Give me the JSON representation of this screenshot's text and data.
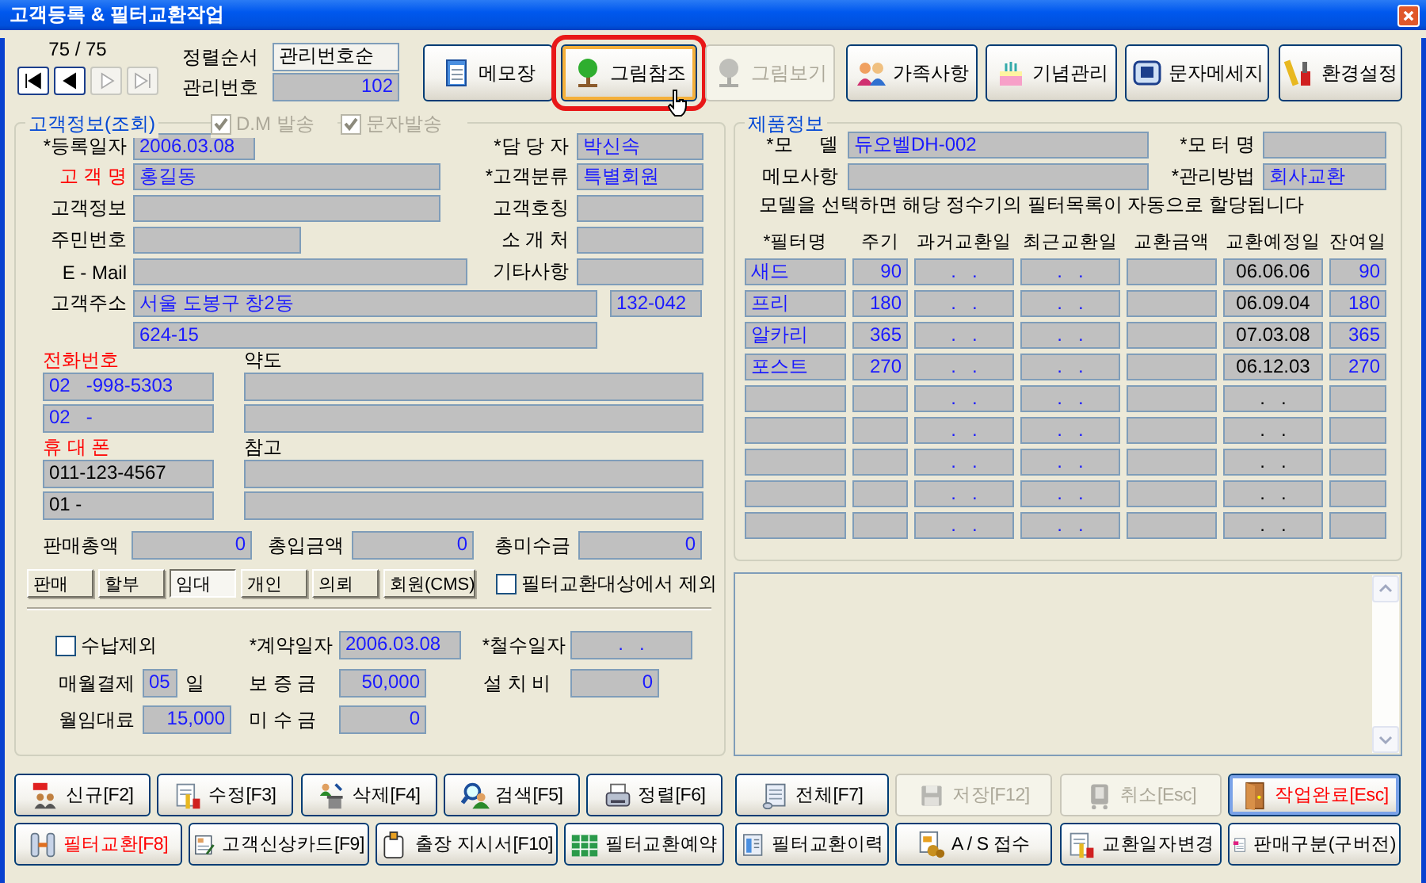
{
  "window": {
    "title": "고객등록 & 필터교환작업"
  },
  "record_nav": {
    "counter": "75 / 75",
    "buttons": [
      {
        "kind": "first",
        "disabled": false
      },
      {
        "kind": "prev",
        "disabled": false
      },
      {
        "kind": "next",
        "disabled": true
      },
      {
        "kind": "last",
        "disabled": true
      }
    ]
  },
  "sort": {
    "label": "정렬순서",
    "value": "관리번호순"
  },
  "manage_no": {
    "label": "관리번호",
    "value": "102"
  },
  "toolbar": [
    {
      "label": "메모장",
      "disabled": false,
      "highlighted": false
    },
    {
      "label": "그림참조",
      "disabled": false,
      "highlighted": true
    },
    {
      "label": "그림보기",
      "disabled": true,
      "highlighted": false
    },
    {
      "label": "가족사항",
      "disabled": false,
      "highlighted": false
    },
    {
      "label": "기념관리",
      "disabled": false,
      "highlighted": false
    },
    {
      "label": "문자메세지",
      "disabled": false,
      "highlighted": false
    },
    {
      "label": "환경설정",
      "disabled": false,
      "highlighted": false
    }
  ],
  "customer": {
    "title": "고객정보(조회)",
    "options": [
      {
        "label": "D.M 발송",
        "checked": true,
        "disabled": true
      },
      {
        "label": "문자발송",
        "checked": true,
        "disabled": true
      }
    ],
    "reg_date": {
      "label": "*등록일자",
      "value": "2006.03.08"
    },
    "name": {
      "label": "고 객 명",
      "value": "홍길동",
      "emphasized": true
    },
    "info": {
      "label": "고객정보"
    },
    "resident_no": {
      "label": "주민번호"
    },
    "email": {
      "label": "E - Mail"
    },
    "address": {
      "label": "고객주소",
      "value": "서울 도봉구 창2동",
      "postal_code": "132-042",
      "detail": "624-15"
    },
    "manager": {
      "label": "*담 당 자",
      "value": "박신속"
    },
    "category": {
      "label": "*고객분류",
      "value": "특별회원"
    },
    "honorific": {
      "label": "고객호칭"
    },
    "referrer": {
      "label": "소 개 처"
    },
    "etc": {
      "label": "기타사항"
    },
    "phone": {
      "label": "전화번호",
      "emphasized": true,
      "values": [
        "02   -998-5303",
        "02   -"
      ]
    },
    "map": {
      "label": "약도"
    },
    "mobile": {
      "label": "휴 대 폰",
      "emphasized": true,
      "values": [
        "011-123-4567",
        "01 -"
      ]
    },
    "note": {
      "label": "참고"
    },
    "totals": [
      {
        "label": "판매총액",
        "value": "0"
      },
      {
        "label": "총입금액",
        "value": "0"
      },
      {
        "label": "총미수금",
        "value": "0"
      }
    ],
    "sale_types": [
      {
        "label": "판매",
        "selected": false
      },
      {
        "label": "할부",
        "selected": false
      },
      {
        "label": "임대",
        "selected": true
      },
      {
        "label": "개인",
        "selected": false
      },
      {
        "label": "의뢰",
        "selected": false
      },
      {
        "label": "회원(CMS)",
        "selected": false
      }
    ],
    "exclude_filter": {
      "label": "필터교환대상에서 제외",
      "checked": false
    }
  },
  "rental": {
    "exclude_payment": {
      "label": "수납제외",
      "checked": false
    },
    "contract_date": {
      "label": "*계약일자",
      "value": "2006.03.08"
    },
    "withdraw_date": {
      "label": "*철수일자",
      "value": ".   ."
    },
    "payment_day": {
      "label": "매월결제",
      "value": "05",
      "unit": "일"
    },
    "deposit": {
      "label": "보 증 금",
      "value": "50,000"
    },
    "install_fee": {
      "label": "설 치 비",
      "value": "0"
    },
    "monthly_fee": {
      "label": "월임대료",
      "value": "15,000"
    },
    "unpaid": {
      "label": "미 수 금",
      "value": "0"
    }
  },
  "product": {
    "title": "제품정보",
    "model": {
      "label": "*모     델",
      "value": "듀오벨DH-002"
    },
    "motor": {
      "label": "*모 터 명"
    },
    "memo": {
      "label": "메모사항"
    },
    "method": {
      "label": "*관리방법",
      "value": "회사교환"
    },
    "notice": "모델을 선택하면 해당 정수기의 필터목록이 자동으로 할당됩니다",
    "filters": {
      "columns": [
        "*필터명",
        "주기",
        "과거교환일",
        "최근교환일",
        "교환금액",
        "교환예정일",
        "잔여일"
      ],
      "rows": [
        {
          "name": "새드",
          "cycle": "90",
          "past": ".   .",
          "recent": ".   .",
          "next": "06.06.06",
          "remaining": "90"
        },
        {
          "name": "프리",
          "cycle": "180",
          "past": ".   .",
          "recent": ".   .",
          "next": "06.09.04",
          "remaining": "180"
        },
        {
          "name": "알카리",
          "cycle": "365",
          "past": ".   .",
          "recent": ".   .",
          "next": "07.03.08",
          "remaining": "365"
        },
        {
          "name": "포스트",
          "cycle": "270",
          "past": ".   .",
          "recent": ".   .",
          "next": "06.12.03",
          "remaining": "270"
        },
        {
          "past": ".   .",
          "recent": ".   .",
          "next": ".   ."
        },
        {
          "past": ".   .",
          "recent": ".   .",
          "next": ".   ."
        },
        {
          "past": ".   .",
          "recent": ".   .",
          "next": ".   ."
        },
        {
          "past": ".   .",
          "recent": ".   .",
          "next": ".   ."
        },
        {
          "past": ".   .",
          "recent": ".   .",
          "next": ".   ."
        }
      ]
    }
  },
  "buttons": [
    [
      {
        "label": "신규[F2]",
        "disabled": false,
        "emphasized": false,
        "focused": false
      },
      {
        "label": "수정[F3]",
        "disabled": false,
        "emphasized": false,
        "focused": false
      },
      {
        "label": "삭제[F4]",
        "disabled": false,
        "emphasized": false,
        "focused": false
      },
      {
        "label": "검색[F5]",
        "disabled": false,
        "emphasized": false,
        "focused": false
      },
      {
        "label": "정렬[F6]",
        "disabled": false,
        "emphasized": false,
        "focused": false
      },
      {
        "label": "전체[F7]",
        "disabled": false,
        "emphasized": false,
        "focused": false
      },
      {
        "label": "저장[F12]",
        "disabled": true,
        "emphasized": false,
        "focused": false
      },
      {
        "label": "취소[Esc]",
        "disabled": true,
        "emphasized": false,
        "focused": false
      },
      {
        "label": "작업완료[Esc]",
        "disabled": false,
        "emphasized": true,
        "focused": true
      }
    ],
    [
      {
        "label": "필터교환[F8]",
        "disabled": false,
        "emphasized": true,
        "focused": false
      },
      {
        "label": "고객신상카드[F9]",
        "disabled": false,
        "emphasized": false,
        "focused": false
      },
      {
        "label": "출장 지시서[F10]",
        "disabled": false,
        "emphasized": false,
        "focused": false
      },
      {
        "label": "필터교환예약",
        "disabled": false,
        "emphasized": false,
        "focused": false
      },
      {
        "label": "필터교환이력",
        "disabled": false,
        "emphasized": false,
        "focused": false
      },
      {
        "label": "A / S 접수",
        "disabled": false,
        "emphasized": false,
        "focused": false
      },
      {
        "label": "교환일자변경",
        "disabled": false,
        "emphasized": false,
        "focused": false
      },
      {
        "label": "판매구분(구버전)",
        "disabled": false,
        "emphasized": false,
        "focused": false
      }
    ]
  ]
}
